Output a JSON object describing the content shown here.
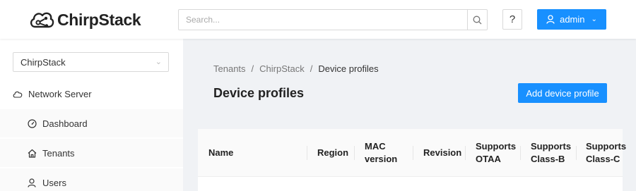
{
  "header": {
    "logo_text": "ChirpStack",
    "search_placeholder": "Search...",
    "help_label": "?",
    "user_label": "admin"
  },
  "sidebar": {
    "tenant_selected": "ChirpStack",
    "network_server_label": "Network Server",
    "items": [
      {
        "label": "Dashboard",
        "icon": "dashboard-icon"
      },
      {
        "label": "Tenants",
        "icon": "home-icon"
      },
      {
        "label": "Users",
        "icon": "user-icon"
      }
    ]
  },
  "main": {
    "breadcrumb": [
      "Tenants",
      "/",
      "ChirpStack",
      "/",
      "Device profiles"
    ],
    "title": "Device profiles",
    "add_button": "Add device profile",
    "table": {
      "columns": [
        {
          "line1": "Name",
          "line2": ""
        },
        {
          "line1": "Region",
          "line2": ""
        },
        {
          "line1": "MAC",
          "line2": "version"
        },
        {
          "line1": "Revision",
          "line2": ""
        },
        {
          "line1": "Supports",
          "line2": "OTAA"
        },
        {
          "line1": "Supports",
          "line2": "Class-B"
        },
        {
          "line1": "Supports",
          "line2": "Class-C"
        }
      ]
    }
  },
  "colors": {
    "primary": "#1890ff",
    "background": "#f0f2f5"
  }
}
